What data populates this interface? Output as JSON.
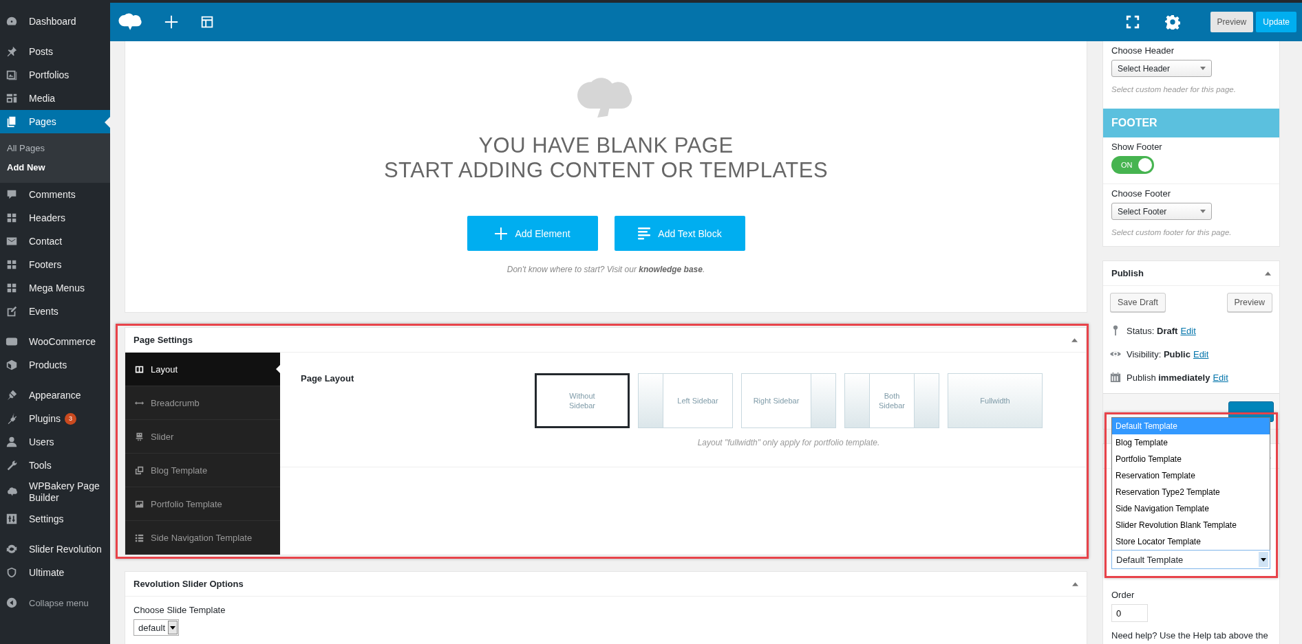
{
  "sidebar": {
    "groups": [
      {
        "items": [
          {
            "label": "Dashboard",
            "selected": false
          }
        ]
      },
      {
        "items": [
          {
            "label": "Posts",
            "selected": false
          },
          {
            "label": "Portfolios",
            "selected": false
          },
          {
            "label": "Media",
            "selected": false
          },
          {
            "label": "Pages",
            "selected": true,
            "children": [
              {
                "label": "All Pages",
                "selected": false
              },
              {
                "label": "Add New",
                "selected": true
              }
            ]
          },
          {
            "label": "Comments",
            "selected": false
          },
          {
            "label": "Headers",
            "selected": false
          },
          {
            "label": "Contact",
            "selected": false
          },
          {
            "label": "Footers",
            "selected": false
          },
          {
            "label": "Mega Menus",
            "selected": false
          },
          {
            "label": "Events",
            "selected": false
          }
        ]
      },
      {
        "items": [
          {
            "label": "WooCommerce",
            "selected": false
          },
          {
            "label": "Products",
            "selected": false
          }
        ]
      },
      {
        "items": [
          {
            "label": "Appearance",
            "selected": false
          },
          {
            "label": "Plugins",
            "selected": false,
            "badge": "3"
          },
          {
            "label": "Users",
            "selected": false
          },
          {
            "label": "Tools",
            "selected": false
          },
          {
            "label": "WPBakery Page Builder",
            "selected": false
          },
          {
            "label": "Settings",
            "selected": false
          }
        ]
      },
      {
        "items": [
          {
            "label": "Slider Revolution",
            "selected": false
          },
          {
            "label": "Ultimate",
            "selected": false
          }
        ]
      }
    ],
    "collapse": "Collapse menu"
  },
  "toolbar": {
    "buttons": [
      {
        "label": "Preview",
        "kind": "secondary"
      },
      {
        "label": "Update",
        "kind": "primary"
      }
    ]
  },
  "blank_page": {
    "heading": [
      "YOU HAVE BLANK PAGE",
      "START ADDING CONTENT OR TEMPLATES"
    ],
    "buttons": [
      {
        "label": "Add Element",
        "kind": "element"
      },
      {
        "label": "Add Text Block",
        "kind": "text"
      }
    ],
    "hint": "Don't know where to start? Visit our **knowledge base**."
  },
  "page_settings": {
    "title": "Page Settings",
    "tabs": [
      {
        "label": "Layout",
        "selected": true
      },
      {
        "label": "Breadcrumb",
        "selected": false
      },
      {
        "label": "Slider",
        "selected": false
      },
      {
        "label": "Blog Template",
        "selected": false
      },
      {
        "label": "Portfolio Template",
        "selected": false
      },
      {
        "label": "Side Navigation Template",
        "selected": false
      }
    ],
    "field_label": "Page Layout",
    "layouts": [
      {
        "label": "Without Sidebar",
        "kind": "none",
        "selected": true
      },
      {
        "label": "Left Sidebar",
        "kind": "left",
        "selected": false
      },
      {
        "label": "Right Sidebar",
        "kind": "right",
        "selected": false
      },
      {
        "label": "Both Sidebar",
        "kind": "both",
        "selected": false
      },
      {
        "label": "Fullwidth",
        "kind": "full",
        "selected": false
      }
    ],
    "note": "Layout \"fullwidth\" only apply for portfolio template."
  },
  "revolution_slider": {
    "title": "Revolution Slider Options",
    "field_label": "Choose Slide Template",
    "value": "default"
  },
  "header_section": {
    "label": "Choose Header",
    "select": "Select Header",
    "hint": "Select custom header for this page."
  },
  "footer_section": {
    "title": "FOOTER",
    "show_label": "Show Footer",
    "toggle": {
      "label": "ON",
      "on": true
    },
    "choose_label": "Choose Footer",
    "select": "Select Footer",
    "hint": "Select custom footer for this page."
  },
  "publish": {
    "title": "Publish",
    "buttons": [
      {
        "label": "Save Draft"
      },
      {
        "label": "Preview"
      }
    ],
    "rows": [
      {
        "label": "Status:",
        "value": "Draft",
        "link": "Edit"
      },
      {
        "label": "Visibility:",
        "value": "Public",
        "link": "Edit"
      },
      {
        "label": "Publish",
        "value": "immediately",
        "link": "Edit"
      }
    ]
  },
  "template_dropdown": {
    "options": [
      {
        "label": "Default Template",
        "selected": true
      },
      {
        "label": "Blog Template",
        "selected": false
      },
      {
        "label": "Portfolio Template",
        "selected": false
      },
      {
        "label": "Reservation Template",
        "selected": false
      },
      {
        "label": "Reservation Type2 Template",
        "selected": false
      },
      {
        "label": "Side Navigation Template",
        "selected": false
      },
      {
        "label": "Slider Revolution Blank Template",
        "selected": false
      },
      {
        "label": "Store Locator Template",
        "selected": false
      }
    ],
    "value": "Default Template"
  },
  "attributes": {
    "order_label": "Order",
    "order_value": "0",
    "help": "Need help? Use the Help tab above the"
  }
}
